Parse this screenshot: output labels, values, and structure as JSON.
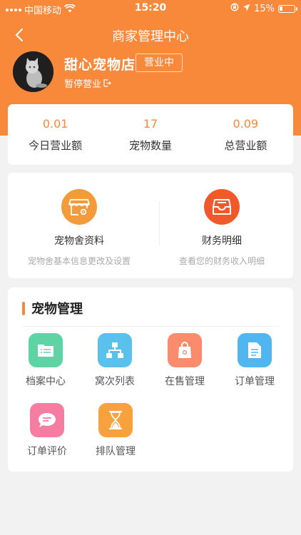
{
  "status": {
    "carrier": "中国移动",
    "time": "15:20",
    "battery": "15%"
  },
  "nav": {
    "title": "商家管理中心"
  },
  "profile": {
    "shop_name": "甜心宠物店",
    "status_badge": "营业中",
    "pause_label": "暂停营业"
  },
  "stats": [
    {
      "value": "0.01",
      "label": "今日营业额"
    },
    {
      "value": "17",
      "label": "宠物数量"
    },
    {
      "value": "0.09",
      "label": "总营业额"
    }
  ],
  "tiles": [
    {
      "title": "宠物舍资料",
      "subtitle": "宠物舍基本信息更改及设置",
      "icon": "store-settings-icon",
      "color": "#f39a3b"
    },
    {
      "title": "财务明细",
      "subtitle": "查看您的财务收入明细",
      "icon": "inbox-tray-icon",
      "color": "#f05a2a"
    }
  ],
  "manage": {
    "title": "宠物管理",
    "items": [
      {
        "label": "档案中心",
        "icon": "folder-icon",
        "color": "#5ed3a4"
      },
      {
        "label": "窝次列表",
        "icon": "hierarchy-icon",
        "color": "#59c1ec"
      },
      {
        "label": "在售管理",
        "icon": "shopping-bag-icon",
        "color": "#fa8b6c"
      },
      {
        "label": "订单管理",
        "icon": "document-icon",
        "color": "#4fb6ef"
      },
      {
        "label": "订单评价",
        "icon": "chat-bubble-icon",
        "color": "#f57da1"
      },
      {
        "label": "排队管理",
        "icon": "hourglass-icon",
        "color": "#f7a23e"
      }
    ]
  },
  "colors": {
    "brand": "#f8883a",
    "background": "#f2f2f2"
  }
}
